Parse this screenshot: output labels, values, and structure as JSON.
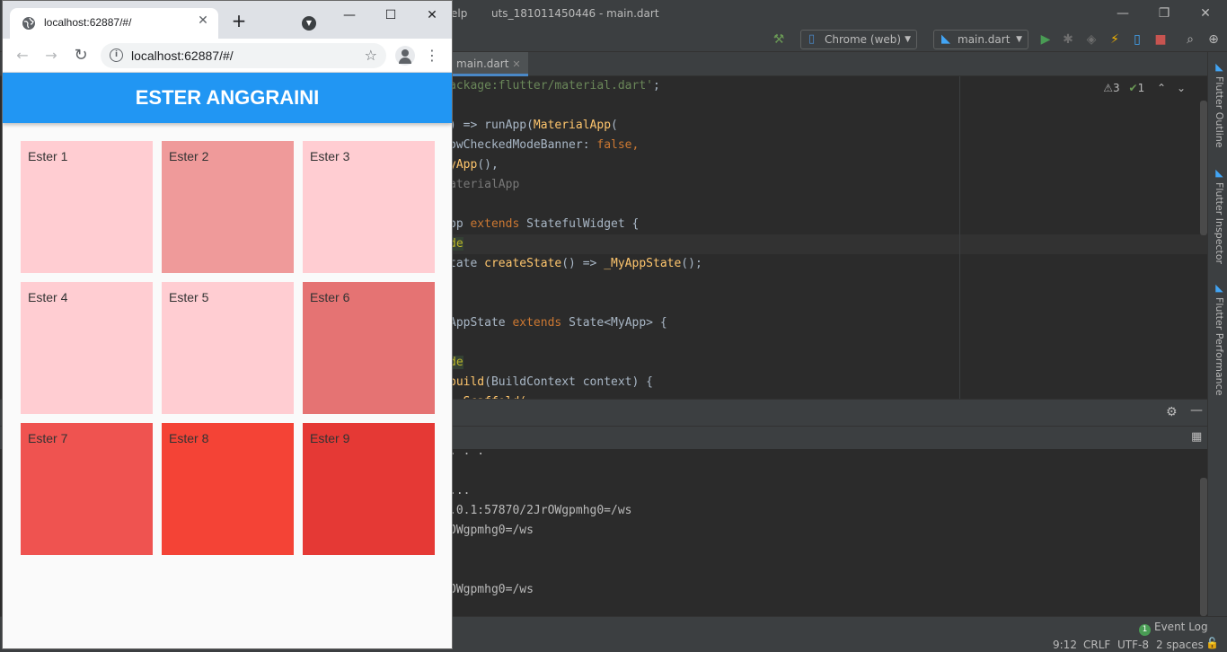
{
  "ide": {
    "menu_help": "elp",
    "window_title": "uts_181011450446 - main.dart",
    "window_controls": {
      "minimize": "—",
      "restore": "❐",
      "close": "✕"
    },
    "toolbar": {
      "device_select": "Chrome (web)",
      "config_select": "main.dart"
    },
    "editor_tab": {
      "label": "main.dart",
      "close": "✕"
    },
    "inspections": {
      "warnings": "3",
      "checks": "1"
    },
    "code_lines": [
      {
        "pre": "",
        "parts": [
          {
            "t": "ackage:flutter/material.dart'",
            "c": "c-str"
          },
          {
            "t": ";",
            "c": ""
          }
        ]
      },
      {
        "parts": []
      },
      {
        "parts": [
          {
            "t": ") => runApp(",
            "c": ""
          },
          {
            "t": "MaterialApp",
            "c": "c-cls"
          },
          {
            "t": "(",
            "c": ""
          }
        ]
      },
      {
        "parts": [
          {
            "t": "owCheckedModeBanner: ",
            "c": ""
          },
          {
            "t": "false",
            "c": "c-kw"
          },
          {
            "t": ",",
            "c": "c-kw"
          }
        ]
      },
      {
        "parts": [
          {
            "t": "yApp",
            "c": "c-cls"
          },
          {
            "t": "(),",
            "c": ""
          }
        ]
      },
      {
        "parts": [
          {
            "t": "aterialApp",
            "c": "c-muted"
          }
        ]
      },
      {
        "parts": []
      },
      {
        "parts": [
          {
            "t": "pp ",
            "c": ""
          },
          {
            "t": "extends ",
            "c": "c-kw"
          },
          {
            "t": "StatefulWidget {",
            "c": ""
          }
        ]
      },
      {
        "parts": [
          {
            "t": "de",
            "c": "c-anno"
          }
        ]
      },
      {
        "parts": [
          {
            "t": "tate ",
            "c": ""
          },
          {
            "t": "createState",
            "c": "c-cls"
          },
          {
            "t": "() => ",
            "c": ""
          },
          {
            "t": "_MyAppState",
            "c": "c-cls"
          },
          {
            "t": "();",
            "c": ""
          }
        ]
      },
      {
        "parts": []
      },
      {
        "parts": []
      },
      {
        "parts": [
          {
            "t": "AppState ",
            "c": ""
          },
          {
            "t": "extends ",
            "c": "c-kw"
          },
          {
            "t": "State<MyApp> {",
            "c": ""
          }
        ]
      },
      {
        "parts": []
      },
      {
        "parts": [
          {
            "t": "de",
            "c": "c-anno"
          }
        ]
      },
      {
        "parts": [
          {
            "t": "build",
            "c": "c-cls"
          },
          {
            "t": "(BuildContext context) {",
            "c": ""
          }
        ]
      },
      {
        "parts": [
          {
            "t": "  Scaffold(",
            "c": "c-cls"
          }
        ]
      }
    ],
    "console_lines": [
      {
        "row": 0,
        "text": ". . ."
      },
      {
        "row": 2,
        "text": "..."
      },
      {
        "row": 3,
        "text": ".0.1:57870/2JrOWgpmhg0=/ws"
      },
      {
        "row": 4,
        "text": "OWgpmhg0=/ws"
      },
      {
        "row": 7,
        "text": "OWgpmhg0=/ws"
      }
    ],
    "side_tabs": [
      "Flutter Outline",
      "Flutter Inspector",
      "Flutter Performance"
    ],
    "status": {
      "event_badge": "1",
      "event_log": "Event Log",
      "position": "9:12",
      "line_sep": "CRLF",
      "encoding": "UTF-8",
      "indent": "2 spaces"
    }
  },
  "browser": {
    "tab_title": "localhost:62887/#/",
    "tab_close": "✕",
    "new_tab": "+",
    "window_controls": {
      "minimize": "—",
      "maximize": "☐",
      "close": "✕"
    },
    "nav": {
      "back": "←",
      "forward": "→",
      "reload": "↻"
    },
    "url": "localhost:62887/#/",
    "star": "☆",
    "menu": "⋮"
  },
  "app": {
    "title": "ESTER ANGGRAINI",
    "tiles": [
      {
        "label": "Ester 1",
        "color": "#ffcdd2"
      },
      {
        "label": "Ester 2",
        "color": "#ef9a9a"
      },
      {
        "label": "Ester 3",
        "color": "#ffcdd2"
      },
      {
        "label": "Ester 4",
        "color": "#ffcdd2"
      },
      {
        "label": "Ester 5",
        "color": "#ffcdd2"
      },
      {
        "label": "Ester 6",
        "color": "#e57373"
      },
      {
        "label": "Ester 7",
        "color": "#ef5350"
      },
      {
        "label": "Ester 8",
        "color": "#f44336"
      },
      {
        "label": "Ester 9",
        "color": "#e53935"
      }
    ]
  },
  "colors": {
    "app_bar": "#2196f3",
    "ide_bg": "#2b2b2b",
    "ide_chrome": "#3c3f41"
  }
}
